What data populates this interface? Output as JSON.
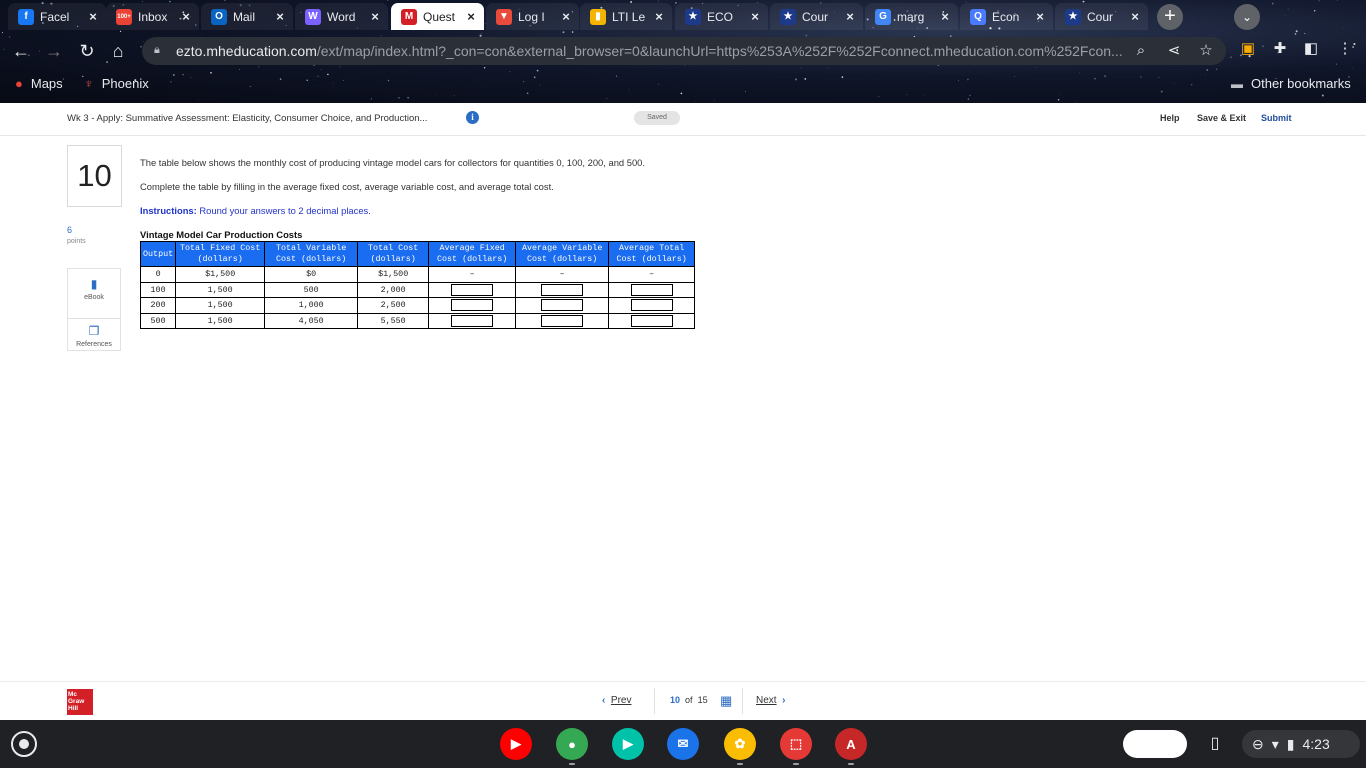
{
  "browser": {
    "tabs": [
      {
        "label": "Facel",
        "favicon": "facebook-icon",
        "color": "#1877f2",
        "glyph": "f"
      },
      {
        "label": "Inbox",
        "favicon": "gmail-icon",
        "color": "#ea4335",
        "glyph": "100+"
      },
      {
        "label": "Mail",
        "favicon": "outlook-icon",
        "color": "#0a64c2",
        "glyph": "O"
      },
      {
        "label": "Word",
        "favicon": "word-icon",
        "color": "#7b61ff",
        "glyph": "W"
      },
      {
        "label": "Quest",
        "favicon": "mcgraw-hill-icon",
        "color": "#d31f26",
        "glyph": "M",
        "active": true
      },
      {
        "label": "Log I",
        "favicon": "phoenix-icon",
        "color": "#e84b3c",
        "glyph": "▼"
      },
      {
        "label": "LTI Le",
        "favicon": "lti-icon",
        "color": "#f4b400",
        "glyph": "▮"
      },
      {
        "label": "ECO",
        "favicon": "course-icon",
        "color": "#1d3a8a",
        "glyph": "★"
      },
      {
        "label": "Cour",
        "favicon": "course-icon",
        "color": "#1d3a8a",
        "glyph": "★"
      },
      {
        "label": "marg",
        "favicon": "google-icon",
        "color": "#4285f4",
        "glyph": "G"
      },
      {
        "label": "Econ",
        "favicon": "search-engine-icon",
        "color": "#4a7bff",
        "glyph": "Q"
      },
      {
        "label": "Cour",
        "favicon": "course-icon",
        "color": "#1d3a8a",
        "glyph": "★"
      }
    ],
    "url_host": "ezto.mheducation.com",
    "url_path": "/ext/map/index.html?_con=con&external_browser=0&launchUrl=https%253A%252F%252Fconnect.mheducation.com%252Fcon...",
    "bookmarks": [
      {
        "label": "Maps",
        "icon": "maps-icon"
      },
      {
        "label": "Phoenix",
        "icon": "phoenix-icon"
      }
    ],
    "other_bookmarks": "Other bookmarks"
  },
  "header": {
    "title": "Wk 3 - Apply: Summative Assessment: Elasticity, Consumer Choice, and Production...",
    "saved": "Saved",
    "help": "Help",
    "save_exit": "Save & Exit",
    "submit": "Submit"
  },
  "question": {
    "number": "10",
    "points_value": "6",
    "points_label": "points",
    "ebook": "eBook",
    "references": "References",
    "text1": "The table below shows the monthly cost of producing vintage model cars for collectors for quantities 0, 100, 200, and 500.",
    "text2": "Complete the table by filling in the average fixed cost, average variable cost, and average total cost.",
    "instructions_label": "Instructions:",
    "instructions_text": " Round your answers to 2 decimal places."
  },
  "table": {
    "caption": "Vintage Model Car Production Costs",
    "headers": [
      [
        "Output",
        ""
      ],
      [
        "Total Fixed Cost",
        "(dollars)"
      ],
      [
        "Total Variable",
        "Cost (dollars)"
      ],
      [
        "Total Cost",
        "(dollars)"
      ],
      [
        "Average Fixed",
        "Cost (dollars)"
      ],
      [
        "Average Variable",
        "Cost (dollars)"
      ],
      [
        "Average Total",
        "Cost (dollars)"
      ]
    ],
    "rows": [
      {
        "output": "0",
        "tfc": "$1,500",
        "tvc": "$0",
        "tc": "$1,500",
        "afc": "–",
        "avc": "–",
        "atc": "–"
      },
      {
        "output": "100",
        "tfc": "1,500",
        "tvc": "500",
        "tc": "2,000",
        "afc": "",
        "avc": "",
        "atc": ""
      },
      {
        "output": "200",
        "tfc": "1,500",
        "tvc": "1,000",
        "tc": "2,500",
        "afc": "",
        "avc": "",
        "atc": ""
      },
      {
        "output": "500",
        "tfc": "1,500",
        "tvc": "4,050",
        "tc": "5,550",
        "afc": "",
        "avc": "",
        "atc": ""
      }
    ]
  },
  "footer": {
    "logo": "Mc Graw Hill",
    "prev": "Prev",
    "current": "10",
    "of_label": "of",
    "total": "15",
    "next": "Next"
  },
  "taskbar": {
    "apps": [
      {
        "name": "youtube-icon",
        "color": "#ff0000",
        "glyph": "▶"
      },
      {
        "name": "chrome-icon",
        "color": "#34a853",
        "glyph": "●"
      },
      {
        "name": "play-store-icon",
        "color": "#00c2a8",
        "glyph": "▶"
      },
      {
        "name": "messages-icon",
        "color": "#1a73e8",
        "glyph": "✉"
      },
      {
        "name": "photos-icon",
        "color": "#fbbc04",
        "glyph": "✿"
      },
      {
        "name": "screencast-icon",
        "color": "#e53935",
        "glyph": "⬚"
      },
      {
        "name": "acrobat-icon",
        "color": "#c62828",
        "glyph": "A"
      }
    ],
    "clock": "4:23"
  }
}
